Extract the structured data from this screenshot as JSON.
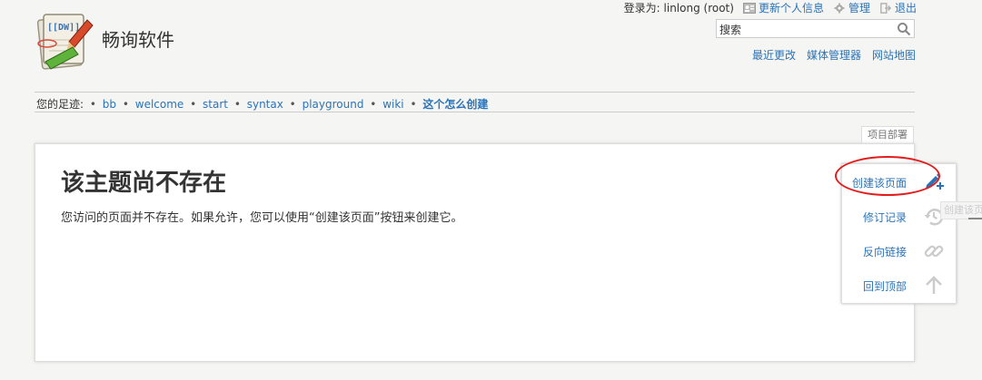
{
  "site": {
    "title": "畅询软件",
    "logo_text": "[[DW]]"
  },
  "usertools": {
    "login_label": "登录为: linlong (root)",
    "profile": "更新个人信息",
    "admin": "管理",
    "logout": "退出"
  },
  "search": {
    "placeholder": "搜索",
    "icon": "search-icon"
  },
  "sitetools": {
    "recent": "最近更改",
    "media": "媒体管理器",
    "sitemap": "网站地图"
  },
  "breadcrumbs": {
    "label": "您的足迹:",
    "separator": "•",
    "items": [
      "bb",
      "welcome",
      "start",
      "syntax",
      "playground",
      "wiki"
    ],
    "current": "这个怎么创建"
  },
  "pageid": "项目部署",
  "main": {
    "heading": "该主题尚不存在",
    "message": "您访问的页面并不存在。如果允许，您可以使用“创建该页面”按钮来创建它。"
  },
  "pagetools": {
    "items": [
      {
        "label": "创建该页面",
        "icon": "create-page-icon"
      },
      {
        "label": "修订记录",
        "icon": "history-icon"
      },
      {
        "label": "反向链接",
        "icon": "link-icon"
      },
      {
        "label": "回到顶部",
        "icon": "arrow-up-icon"
      }
    ]
  },
  "tooltip": "创建该页面",
  "colors": {
    "link": "#2b73b7",
    "highlight": "#e21d1d",
    "background": "#f5f5f3"
  }
}
